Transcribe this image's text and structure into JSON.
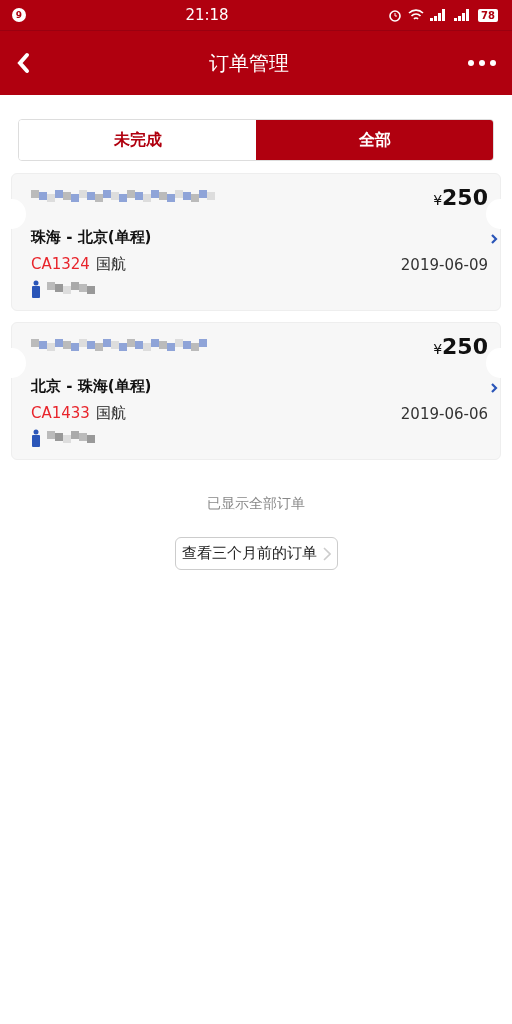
{
  "status_bar": {
    "notification_count": "9",
    "time": "21:18",
    "battery": "78"
  },
  "header": {
    "title": "订单管理"
  },
  "tabs": [
    {
      "label": "未完成",
      "selected": false
    },
    {
      "label": "全部",
      "selected": true
    }
  ],
  "orders": [
    {
      "price_symbol": "¥",
      "price": "250",
      "route": "珠海 - 北京(单程)",
      "flight_number": "CA1324",
      "airline": "国航",
      "date": "2019-06-09"
    },
    {
      "price_symbol": "¥",
      "price": "250",
      "route": "北京 - 珠海(单程)",
      "flight_number": "CA1433",
      "airline": "国航",
      "date": "2019-06-06"
    }
  ],
  "footer_note": "已显示全部订单",
  "older_orders_button": "查看三个月前的订单"
}
